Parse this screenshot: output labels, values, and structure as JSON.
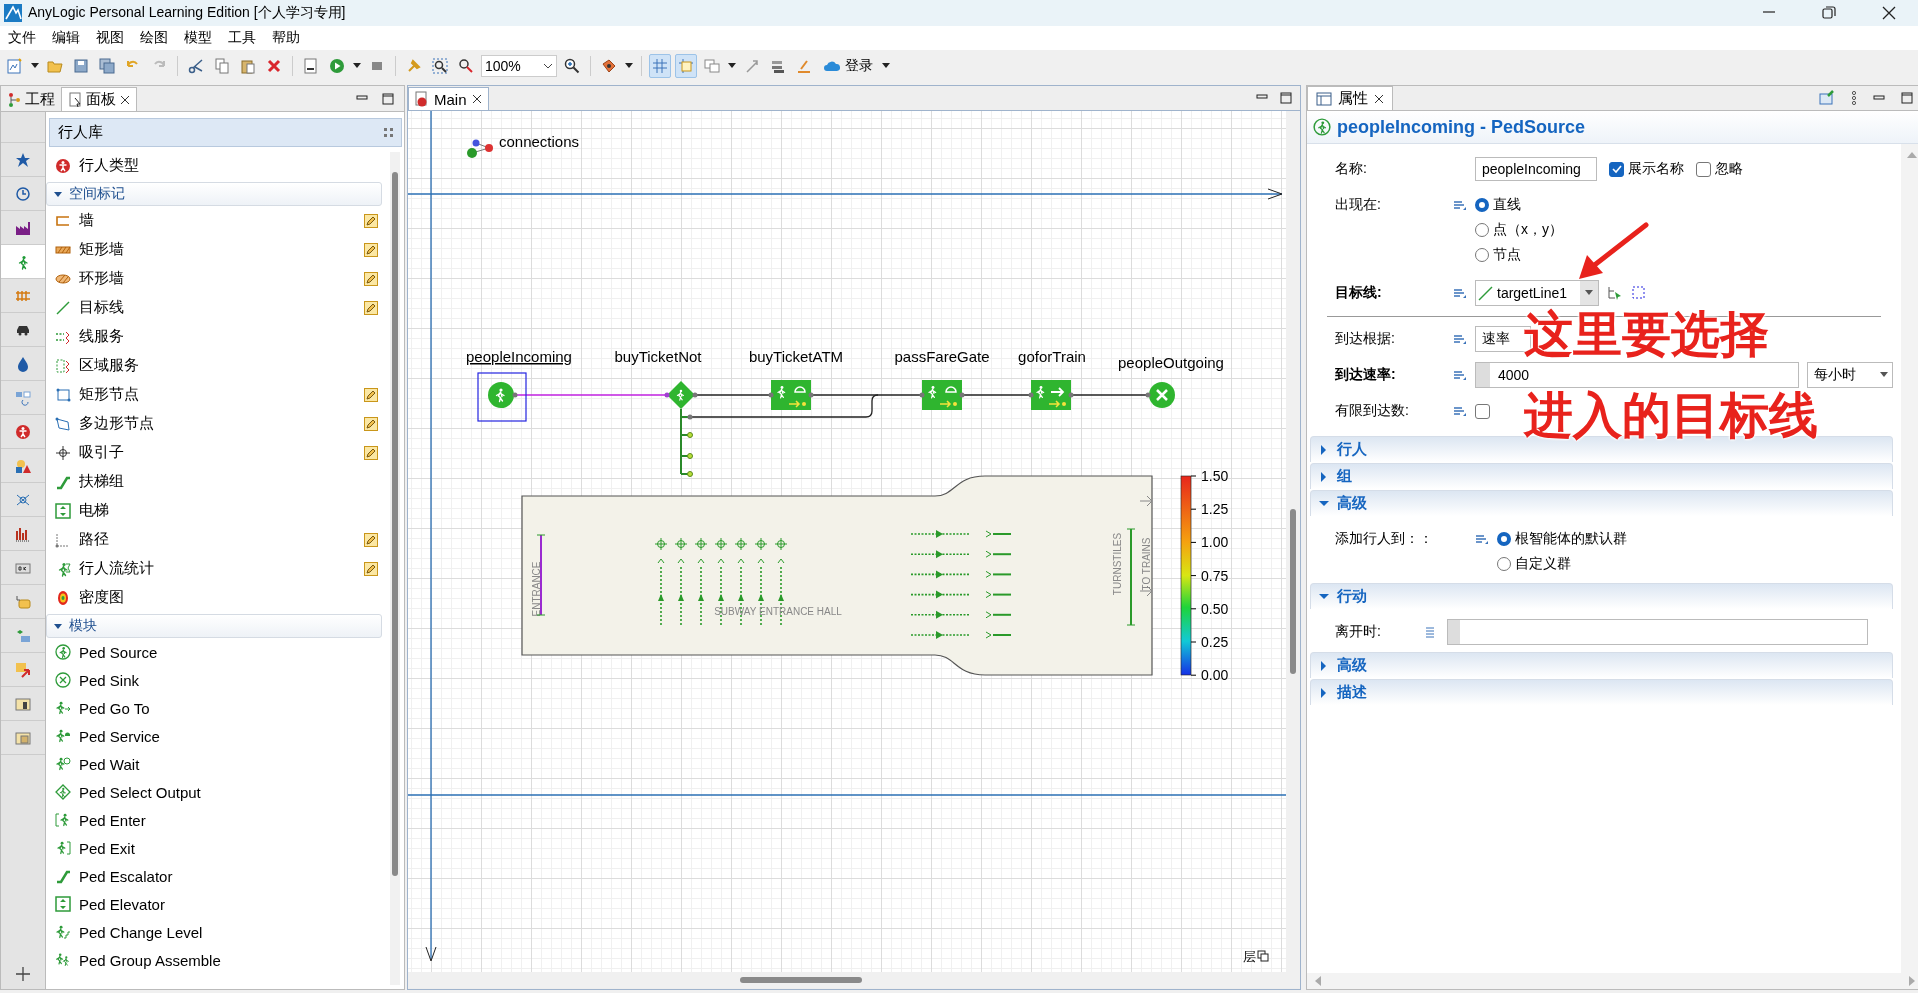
{
  "window": {
    "title": "AnyLogic Personal Learning Edition [个人学习专用]"
  },
  "menu": [
    "文件",
    "编辑",
    "视图",
    "绘图",
    "模型",
    "工具",
    "帮助"
  ],
  "toolbar": {
    "zoom": "100%",
    "grid_on": true,
    "snap_on": true,
    "login": "登录"
  },
  "left_panel": {
    "tabs": [
      {
        "label": "工程",
        "selected": false
      },
      {
        "label": "面板",
        "selected": true
      }
    ],
    "category_tabs": [
      {
        "selected": false
      },
      {
        "selected": false
      },
      {
        "selected": false
      },
      {
        "selected": true
      },
      {
        "selected": false
      },
      {
        "selected": false
      },
      {
        "selected": false
      },
      {
        "selected": false
      },
      {
        "selected": false
      },
      {
        "selected": false
      },
      {
        "selected": false
      },
      {
        "selected": false
      },
      {
        "selected": false
      },
      {
        "selected": false
      },
      {
        "selected": false
      },
      {
        "selected": false
      },
      {
        "selected": false
      },
      {
        "selected": false
      }
    ],
    "library": "行人库",
    "items": [
      {
        "kind": "item",
        "label": "行人类型",
        "draw_mode": false
      },
      {
        "kind": "header",
        "label": "空间标记",
        "expanded": true
      },
      {
        "kind": "item",
        "label": "墙",
        "draw_mode": true
      },
      {
        "kind": "item",
        "label": "矩形墙",
        "draw_mode": true
      },
      {
        "kind": "item",
        "label": "环形墙",
        "draw_mode": true
      },
      {
        "kind": "item",
        "label": "目标线",
        "draw_mode": true
      },
      {
        "kind": "item",
        "label": "线服务",
        "draw_mode": false
      },
      {
        "kind": "item",
        "label": "区域服务",
        "draw_mode": false
      },
      {
        "kind": "item",
        "label": "矩形节点",
        "draw_mode": true
      },
      {
        "kind": "item",
        "label": "多边形节点",
        "draw_mode": true
      },
      {
        "kind": "item",
        "label": "吸引子",
        "draw_mode": true
      },
      {
        "kind": "item",
        "label": "扶梯组",
        "draw_mode": false
      },
      {
        "kind": "item",
        "label": "电梯",
        "draw_mode": false
      },
      {
        "kind": "item",
        "label": "路径",
        "draw_mode": true
      },
      {
        "kind": "item",
        "label": "行人流统计",
        "draw_mode": true
      },
      {
        "kind": "item",
        "label": "密度图",
        "draw_mode": false
      },
      {
        "kind": "header",
        "label": "模块",
        "expanded": true
      },
      {
        "kind": "item",
        "label": "Ped Source",
        "draw_mode": false
      },
      {
        "kind": "item",
        "label": "Ped Sink",
        "draw_mode": false
      },
      {
        "kind": "item",
        "label": "Ped Go To",
        "draw_mode": false
      },
      {
        "kind": "item",
        "label": "Ped Service",
        "draw_mode": false
      },
      {
        "kind": "item",
        "label": "Ped Wait",
        "draw_mode": false
      },
      {
        "kind": "item",
        "label": "Ped Select Output",
        "draw_mode": false
      },
      {
        "kind": "item",
        "label": "Ped Enter",
        "draw_mode": false
      },
      {
        "kind": "item",
        "label": "Ped Exit",
        "draw_mode": false
      },
      {
        "kind": "item",
        "label": "Ped Escalator",
        "draw_mode": false
      },
      {
        "kind": "item",
        "label": "Ped Elevator",
        "draw_mode": false
      },
      {
        "kind": "item",
        "label": "Ped Change Level",
        "draw_mode": false
      },
      {
        "kind": "item",
        "label": "Ped Group Assemble",
        "draw_mode": false
      }
    ]
  },
  "editor": {
    "tabs": [
      {
        "label": "Main",
        "selected": true
      }
    ],
    "connections_label": "connections",
    "blocks": [
      {
        "name": "peopleIncoming",
        "kind": "source",
        "selected": true
      },
      {
        "name": "buyTicketNot",
        "kind": "select",
        "selected": false
      },
      {
        "name": "buyTicketATM",
        "kind": "service",
        "selected": false
      },
      {
        "name": "passFareGate",
        "kind": "service",
        "selected": false
      },
      {
        "name": "goforTrain",
        "kind": "goto",
        "selected": false
      },
      {
        "name": "peopleOutgoing",
        "kind": "sink",
        "selected": false
      }
    ],
    "hall": {
      "entrance": "ENTRANCE",
      "title": "SUBWAY ENTRANCE HALL",
      "turnstiles": "TURNSTILES",
      "exit": "TO TRAINS"
    },
    "legend": [
      "1.50",
      "1.25",
      "1.00",
      "0.75",
      "0.50",
      "0.25",
      "0.00"
    ],
    "layer_label": "层"
  },
  "properties": {
    "tab": {
      "label": "属性",
      "selected": true
    },
    "title": "peopleIncoming - PedSource",
    "name": {
      "label": "名称:",
      "value": "peopleIncoming"
    },
    "checks": [
      {
        "label": "展示名称",
        "checked": true
      },
      {
        "label": "忽略",
        "checked": false
      }
    ],
    "appear": {
      "label": "出现在:",
      "options": [
        {
          "label": "直线",
          "selected": true
        },
        {
          "label": "点（x，y）",
          "selected": false
        },
        {
          "label": "节点",
          "selected": false
        }
      ]
    },
    "target": {
      "label": "目标线:",
      "emphasized": true,
      "value": "targetLine1"
    },
    "arrival": {
      "label": "到达根据:",
      "emphasized": false,
      "value": "速率"
    },
    "rate": {
      "label": "到达速率:",
      "emphasized": true,
      "value": "4000",
      "unit": "每小时"
    },
    "limited": {
      "label": "有限到达数:",
      "emphasized": false,
      "checked": false
    },
    "sections": [
      {
        "title": "行人",
        "expanded": false
      },
      {
        "title": "组",
        "expanded": false
      },
      {
        "title": "高级",
        "expanded": true,
        "kind": "radio",
        "label": "添加行人到：：",
        "options": [
          {
            "label": "根智能体的默认群",
            "selected": true
          },
          {
            "label": "自定义群",
            "selected": false
          }
        ]
      },
      {
        "title": "行动",
        "expanded": true,
        "kind": "code",
        "label": "离开时:"
      },
      {
        "title": "高级",
        "expanded": false
      },
      {
        "title": "描述",
        "expanded": false
      }
    ]
  },
  "annotation": {
    "lines": [
      "这里要选择",
      "进入的目标线"
    ]
  }
}
